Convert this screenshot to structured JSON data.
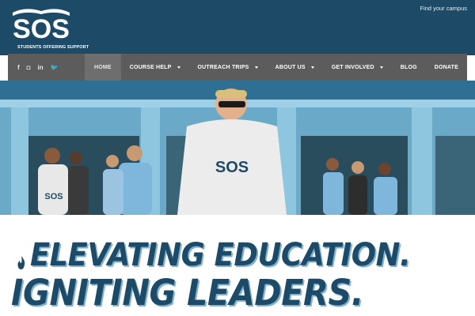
{
  "brand": {
    "logo_text": "SOS",
    "tagline": "STUDENTS OFFERING SUPPORT"
  },
  "header": {
    "find_campus": "Find your campus"
  },
  "social": [
    {
      "icon": "facebook-icon",
      "glyph": "f"
    },
    {
      "icon": "instagram-icon",
      "glyph": "◘"
    },
    {
      "icon": "linkedin-icon",
      "glyph": "in"
    },
    {
      "icon": "twitter-icon",
      "glyph": "🐦"
    }
  ],
  "nav": {
    "items": [
      {
        "label": "HOME",
        "active": true,
        "dropdown": false
      },
      {
        "label": "COURSE HELP",
        "active": false,
        "dropdown": true
      },
      {
        "label": "OUTREACH TRIPS",
        "active": false,
        "dropdown": true
      },
      {
        "label": "ABOUT US",
        "active": false,
        "dropdown": true
      },
      {
        "label": "GET INVOLVED",
        "active": false,
        "dropdown": true
      },
      {
        "label": "BLOG",
        "active": false,
        "dropdown": false
      },
      {
        "label": "DONATE",
        "active": false,
        "dropdown": false
      }
    ]
  },
  "hero": {
    "shirt_text": "SOS"
  },
  "headline": {
    "line1": "ELEVATING EDUCATION.",
    "line2": "IGNITING LEADERS."
  },
  "colors": {
    "brand_navy": "#1d4a66",
    "nav_gray": "#5c5c5c",
    "accent_light_blue": "#7fb3d6"
  }
}
